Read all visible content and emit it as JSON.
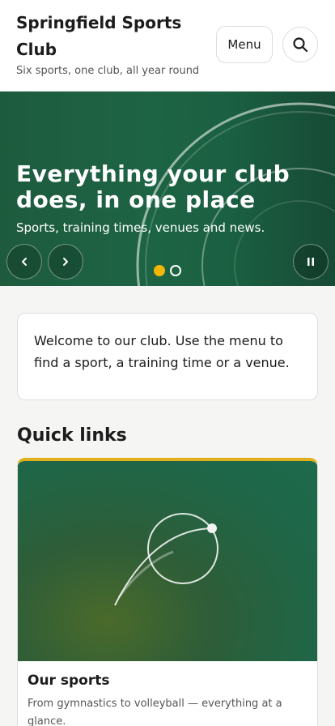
{
  "header": {
    "site_title": "Springfield Sports Club",
    "tagline": "Six sports, one club, all year round",
    "menu_label": "Menu",
    "search_icon": "search-icon"
  },
  "hero": {
    "heading": "Everything your club does, in one place",
    "subheading": "Sports, training times, venues and news.",
    "slide_count": 2,
    "active_slide": 1,
    "icons": {
      "prev": "chevron-left-icon",
      "next": "chevron-right-icon",
      "pause": "pause-icon"
    },
    "colors": {
      "background": "#1d6444",
      "active_dot": "#f2b705"
    }
  },
  "welcome": {
    "text": "Welcome to our club. Use the menu to find a sport, a training time or a venue."
  },
  "quick_links": {
    "heading": "Quick links",
    "cards": [
      {
        "title": "Our sports",
        "description": "From gymnastics to volleyball — everything at a glance."
      }
    ],
    "accent_color": "#e0b01c"
  }
}
